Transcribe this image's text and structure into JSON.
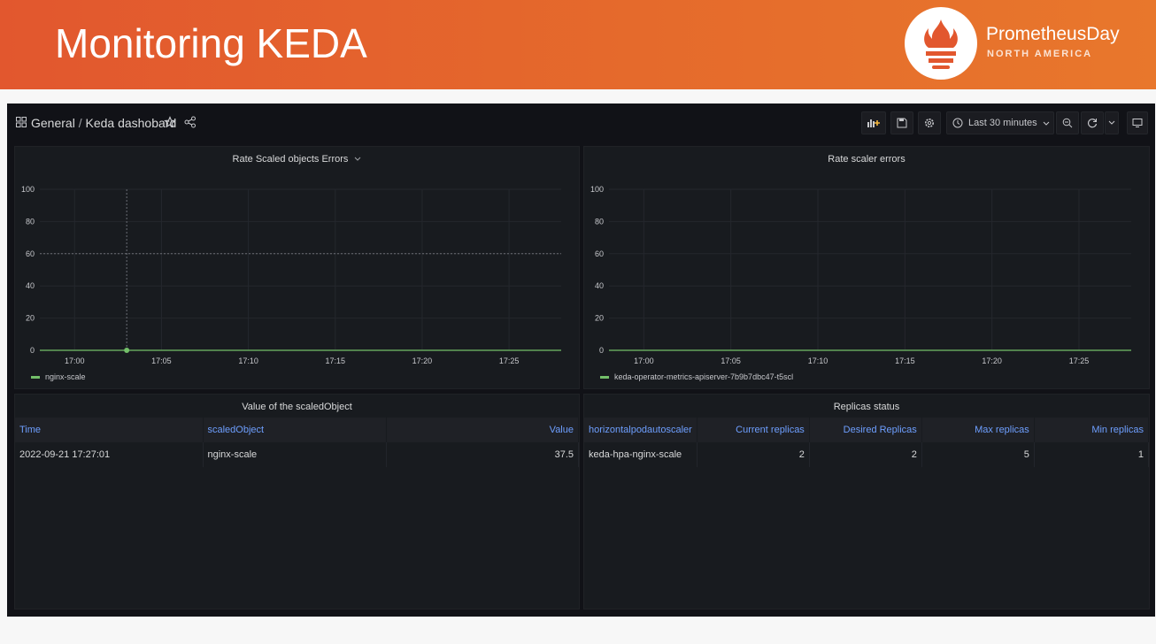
{
  "slide": {
    "title": "Monitoring KEDA",
    "logo_name": "PrometheusDay",
    "logo_sub": "NORTH AMERICA",
    "accent": "#e2572e"
  },
  "dashboard": {
    "folder": "General",
    "separator": "/",
    "name": "Keda dashobard",
    "time_range": "Last 30 minutes"
  },
  "toolbar": {
    "icons": [
      "add-panel-icon",
      "save-icon",
      "settings-icon",
      "clock-icon",
      "zoom-out-icon",
      "refresh-icon",
      "tv-mode-icon"
    ]
  },
  "panels": {
    "rate_scaled": {
      "title": "Rate Scaled objects Errors"
    },
    "rate_scaler": {
      "title": "Rate scaler errors"
    },
    "value_table": {
      "title": "Value of the scaledObject",
      "columns": [
        "Time",
        "scaledObject",
        "Value"
      ],
      "rows": [
        [
          "2022-09-21 17:27:01",
          "nginx-scale",
          "37.5"
        ]
      ]
    },
    "replicas_table": {
      "title": "Replicas status",
      "columns": [
        "horizontalpodautoscaler",
        "Current replicas",
        "Desired Replicas",
        "Max replicas",
        "Min replicas"
      ],
      "rows": [
        [
          "keda-hpa-nginx-scale",
          "2",
          "2",
          "5",
          "1"
        ]
      ]
    }
  },
  "chart_data": [
    {
      "type": "line",
      "title": "Rate Scaled objects Errors",
      "x": [
        "16:58",
        "17:00",
        "17:03",
        "17:05",
        "17:10",
        "17:15",
        "17:20",
        "17:25",
        "17:28"
      ],
      "x_ticks": [
        "17:00",
        "17:05",
        "17:10",
        "17:15",
        "17:20",
        "17:25"
      ],
      "y_ticks": [
        0,
        20,
        40,
        60,
        80,
        100
      ],
      "ylim": [
        0,
        100
      ],
      "grid": true,
      "series": [
        {
          "name": "nginx-scale",
          "color": "#73bf69",
          "values": [
            0,
            0,
            0,
            0,
            0,
            0,
            0,
            0,
            0
          ]
        }
      ],
      "legend": "bottom-left"
    },
    {
      "type": "line",
      "title": "Rate scaler errors",
      "x": [
        "16:58",
        "17:00",
        "17:05",
        "17:10",
        "17:15",
        "17:20",
        "17:25",
        "17:28"
      ],
      "x_ticks": [
        "17:00",
        "17:05",
        "17:10",
        "17:15",
        "17:20",
        "17:25"
      ],
      "y_ticks": [
        0,
        20,
        40,
        60,
        80,
        100
      ],
      "ylim": [
        0,
        100
      ],
      "grid": true,
      "series": [
        {
          "name": "keda-operator-metrics-apiserver-7b9b7dbc47-t5scl",
          "color": "#73bf69",
          "values": [
            0,
            0,
            0,
            0,
            0,
            0,
            0,
            0
          ]
        }
      ],
      "legend": "bottom-left"
    }
  ]
}
